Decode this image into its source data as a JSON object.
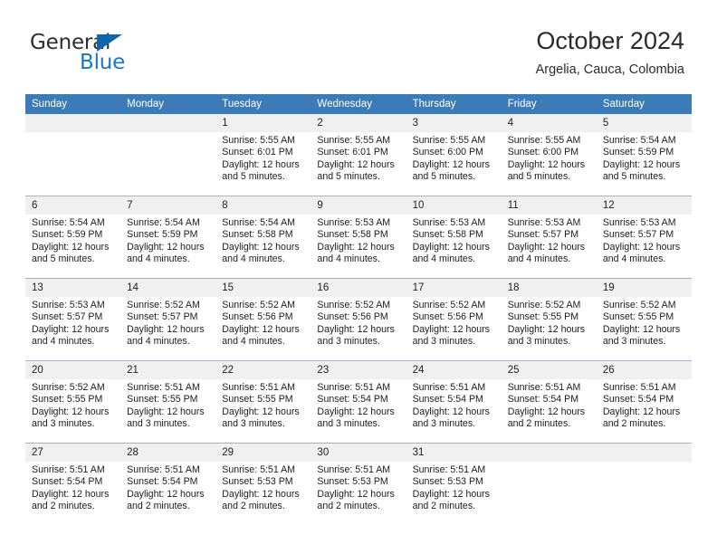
{
  "brand": {
    "name_top": "General",
    "name_bottom": "Blue",
    "triangle_color": "#1064a8",
    "blue_color": "#1877c4"
  },
  "header": {
    "title": "October 2024",
    "subtitle": "Argelia, Cauca, Colombia"
  },
  "theme": {
    "header_row_bg": "#3b7cb8",
    "header_row_text": "#ffffff",
    "daynum_bg": "#f0f0f0",
    "cell_border": "#9bb7d4",
    "body_bg": "#ffffff"
  },
  "weekday_headers": [
    "Sunday",
    "Monday",
    "Tuesday",
    "Wednesday",
    "Thursday",
    "Friday",
    "Saturday"
  ],
  "labels": {
    "sunrise_prefix": "Sunrise:",
    "sunset_prefix": "Sunset:",
    "daylight_prefix": "Daylight:"
  },
  "weeks": [
    [
      {
        "day": "",
        "blank": true,
        "sunrise": "",
        "sunset": "",
        "daylight_line1": "",
        "daylight_line2": ""
      },
      {
        "day": "",
        "blank": true,
        "sunrise": "",
        "sunset": "",
        "daylight_line1": "",
        "daylight_line2": ""
      },
      {
        "day": "1",
        "blank": false,
        "sunrise": "Sunrise: 5:55 AM",
        "sunset": "Sunset: 6:01 PM",
        "daylight_line1": "Daylight: 12 hours",
        "daylight_line2": "and 5 minutes."
      },
      {
        "day": "2",
        "blank": false,
        "sunrise": "Sunrise: 5:55 AM",
        "sunset": "Sunset: 6:01 PM",
        "daylight_line1": "Daylight: 12 hours",
        "daylight_line2": "and 5 minutes."
      },
      {
        "day": "3",
        "blank": false,
        "sunrise": "Sunrise: 5:55 AM",
        "sunset": "Sunset: 6:00 PM",
        "daylight_line1": "Daylight: 12 hours",
        "daylight_line2": "and 5 minutes."
      },
      {
        "day": "4",
        "blank": false,
        "sunrise": "Sunrise: 5:55 AM",
        "sunset": "Sunset: 6:00 PM",
        "daylight_line1": "Daylight: 12 hours",
        "daylight_line2": "and 5 minutes."
      },
      {
        "day": "5",
        "blank": false,
        "sunrise": "Sunrise: 5:54 AM",
        "sunset": "Sunset: 5:59 PM",
        "daylight_line1": "Daylight: 12 hours",
        "daylight_line2": "and 5 minutes."
      }
    ],
    [
      {
        "day": "6",
        "blank": false,
        "sunrise": "Sunrise: 5:54 AM",
        "sunset": "Sunset: 5:59 PM",
        "daylight_line1": "Daylight: 12 hours",
        "daylight_line2": "and 5 minutes."
      },
      {
        "day": "7",
        "blank": false,
        "sunrise": "Sunrise: 5:54 AM",
        "sunset": "Sunset: 5:59 PM",
        "daylight_line1": "Daylight: 12 hours",
        "daylight_line2": "and 4 minutes."
      },
      {
        "day": "8",
        "blank": false,
        "sunrise": "Sunrise: 5:54 AM",
        "sunset": "Sunset: 5:58 PM",
        "daylight_line1": "Daylight: 12 hours",
        "daylight_line2": "and 4 minutes."
      },
      {
        "day": "9",
        "blank": false,
        "sunrise": "Sunrise: 5:53 AM",
        "sunset": "Sunset: 5:58 PM",
        "daylight_line1": "Daylight: 12 hours",
        "daylight_line2": "and 4 minutes."
      },
      {
        "day": "10",
        "blank": false,
        "sunrise": "Sunrise: 5:53 AM",
        "sunset": "Sunset: 5:58 PM",
        "daylight_line1": "Daylight: 12 hours",
        "daylight_line2": "and 4 minutes."
      },
      {
        "day": "11",
        "blank": false,
        "sunrise": "Sunrise: 5:53 AM",
        "sunset": "Sunset: 5:57 PM",
        "daylight_line1": "Daylight: 12 hours",
        "daylight_line2": "and 4 minutes."
      },
      {
        "day": "12",
        "blank": false,
        "sunrise": "Sunrise: 5:53 AM",
        "sunset": "Sunset: 5:57 PM",
        "daylight_line1": "Daylight: 12 hours",
        "daylight_line2": "and 4 minutes."
      }
    ],
    [
      {
        "day": "13",
        "blank": false,
        "sunrise": "Sunrise: 5:53 AM",
        "sunset": "Sunset: 5:57 PM",
        "daylight_line1": "Daylight: 12 hours",
        "daylight_line2": "and 4 minutes."
      },
      {
        "day": "14",
        "blank": false,
        "sunrise": "Sunrise: 5:52 AM",
        "sunset": "Sunset: 5:57 PM",
        "daylight_line1": "Daylight: 12 hours",
        "daylight_line2": "and 4 minutes."
      },
      {
        "day": "15",
        "blank": false,
        "sunrise": "Sunrise: 5:52 AM",
        "sunset": "Sunset: 5:56 PM",
        "daylight_line1": "Daylight: 12 hours",
        "daylight_line2": "and 4 minutes."
      },
      {
        "day": "16",
        "blank": false,
        "sunrise": "Sunrise: 5:52 AM",
        "sunset": "Sunset: 5:56 PM",
        "daylight_line1": "Daylight: 12 hours",
        "daylight_line2": "and 3 minutes."
      },
      {
        "day": "17",
        "blank": false,
        "sunrise": "Sunrise: 5:52 AM",
        "sunset": "Sunset: 5:56 PM",
        "daylight_line1": "Daylight: 12 hours",
        "daylight_line2": "and 3 minutes."
      },
      {
        "day": "18",
        "blank": false,
        "sunrise": "Sunrise: 5:52 AM",
        "sunset": "Sunset: 5:55 PM",
        "daylight_line1": "Daylight: 12 hours",
        "daylight_line2": "and 3 minutes."
      },
      {
        "day": "19",
        "blank": false,
        "sunrise": "Sunrise: 5:52 AM",
        "sunset": "Sunset: 5:55 PM",
        "daylight_line1": "Daylight: 12 hours",
        "daylight_line2": "and 3 minutes."
      }
    ],
    [
      {
        "day": "20",
        "blank": false,
        "sunrise": "Sunrise: 5:52 AM",
        "sunset": "Sunset: 5:55 PM",
        "daylight_line1": "Daylight: 12 hours",
        "daylight_line2": "and 3 minutes."
      },
      {
        "day": "21",
        "blank": false,
        "sunrise": "Sunrise: 5:51 AM",
        "sunset": "Sunset: 5:55 PM",
        "daylight_line1": "Daylight: 12 hours",
        "daylight_line2": "and 3 minutes."
      },
      {
        "day": "22",
        "blank": false,
        "sunrise": "Sunrise: 5:51 AM",
        "sunset": "Sunset: 5:55 PM",
        "daylight_line1": "Daylight: 12 hours",
        "daylight_line2": "and 3 minutes."
      },
      {
        "day": "23",
        "blank": false,
        "sunrise": "Sunrise: 5:51 AM",
        "sunset": "Sunset: 5:54 PM",
        "daylight_line1": "Daylight: 12 hours",
        "daylight_line2": "and 3 minutes."
      },
      {
        "day": "24",
        "blank": false,
        "sunrise": "Sunrise: 5:51 AM",
        "sunset": "Sunset: 5:54 PM",
        "daylight_line1": "Daylight: 12 hours",
        "daylight_line2": "and 3 minutes."
      },
      {
        "day": "25",
        "blank": false,
        "sunrise": "Sunrise: 5:51 AM",
        "sunset": "Sunset: 5:54 PM",
        "daylight_line1": "Daylight: 12 hours",
        "daylight_line2": "and 2 minutes."
      },
      {
        "day": "26",
        "blank": false,
        "sunrise": "Sunrise: 5:51 AM",
        "sunset": "Sunset: 5:54 PM",
        "daylight_line1": "Daylight: 12 hours",
        "daylight_line2": "and 2 minutes."
      }
    ],
    [
      {
        "day": "27",
        "blank": false,
        "sunrise": "Sunrise: 5:51 AM",
        "sunset": "Sunset: 5:54 PM",
        "daylight_line1": "Daylight: 12 hours",
        "daylight_line2": "and 2 minutes."
      },
      {
        "day": "28",
        "blank": false,
        "sunrise": "Sunrise: 5:51 AM",
        "sunset": "Sunset: 5:54 PM",
        "daylight_line1": "Daylight: 12 hours",
        "daylight_line2": "and 2 minutes."
      },
      {
        "day": "29",
        "blank": false,
        "sunrise": "Sunrise: 5:51 AM",
        "sunset": "Sunset: 5:53 PM",
        "daylight_line1": "Daylight: 12 hours",
        "daylight_line2": "and 2 minutes."
      },
      {
        "day": "30",
        "blank": false,
        "sunrise": "Sunrise: 5:51 AM",
        "sunset": "Sunset: 5:53 PM",
        "daylight_line1": "Daylight: 12 hours",
        "daylight_line2": "and 2 minutes."
      },
      {
        "day": "31",
        "blank": false,
        "sunrise": "Sunrise: 5:51 AM",
        "sunset": "Sunset: 5:53 PM",
        "daylight_line1": "Daylight: 12 hours",
        "daylight_line2": "and 2 minutes."
      },
      {
        "day": "",
        "blank": true,
        "sunrise": "",
        "sunset": "",
        "daylight_line1": "",
        "daylight_line2": ""
      },
      {
        "day": "",
        "blank": true,
        "sunrise": "",
        "sunset": "",
        "daylight_line1": "",
        "daylight_line2": ""
      }
    ]
  ]
}
